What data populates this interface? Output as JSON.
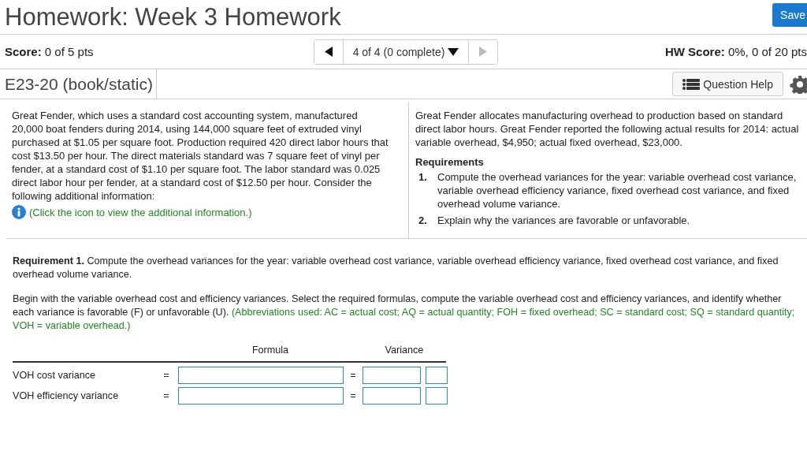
{
  "title": "Homework: Week 3 Homework",
  "save_button": "Save",
  "score": {
    "label": "Score:",
    "value": "0 of 5 pts"
  },
  "nav": {
    "position": "4 of 4 (0 complete)",
    "prev_disabled": false,
    "next_disabled": true
  },
  "hw_score": {
    "label": "HW Score:",
    "value": "0%, 0 of 20 pts"
  },
  "question_id": "E23-20 (book/static)",
  "help_button": "Question Help",
  "problem": {
    "left_text": "Great Fender, which uses a standard cost accounting system, manufactured 20,000 boat fenders during 2014, using 144,000 square feet of extruded vinyl purchased at $1.05 per square foot. Production required 420 direct labor hours that cost $13.50 per hour. The direct materials standard was 7 square feet of vinyl per fender, at a standard cost of $1.10 per square foot. The labor standard was 0.025 direct labor hour per fender, at a standard cost of $12.50 per hour. Consider the following additional information:",
    "info_link": "(Click the icon to view the additional information.)",
    "right_text": "Great Fender allocates manufacturing overhead to production based on standard direct labor hours. Great Fender reported the following actual results for 2014: actual variable overhead, $4,950; actual fixed overhead, $23,000.",
    "requirements_title": "Requirements",
    "requirements": [
      {
        "number": "1.",
        "text": "Compute the overhead variances for the year: variable overhead cost variance, variable overhead efficiency variance, fixed overhead cost variance, and fixed overhead volume variance."
      },
      {
        "number": "2.",
        "text": "Explain why the variances are favorable or unfavorable."
      }
    ]
  },
  "requirement": "**Requirement 1.** Compute the overhead variances for the year: variable overhead cost variance, variable overhead efficiency variance, fixed overhead cost variance, and fixed overhead volume variance.",
  "instructions": "Begin with the variable overhead cost and efficiency variances. Select the required formulas, compute the variable overhead cost and efficiency variances, and identify whether each variance is favorable (F) or unfavorable (U).",
  "abbreviations": "(Abbreviations used: AC = actual cost; AQ = actual quantity; FOH = fixed overhead; SC = standard cost; SQ = standard quantity; VOH = variable overhead.)",
  "table": {
    "columns": [
      "Formula",
      "Variance"
    ],
    "rows": [
      {
        "label": "VOH cost variance",
        "sign_1": "=",
        "sign_2": "="
      },
      {
        "label": "VOH efficiency variance",
        "sign_1": "=",
        "sign_2": "="
      }
    ]
  }
}
